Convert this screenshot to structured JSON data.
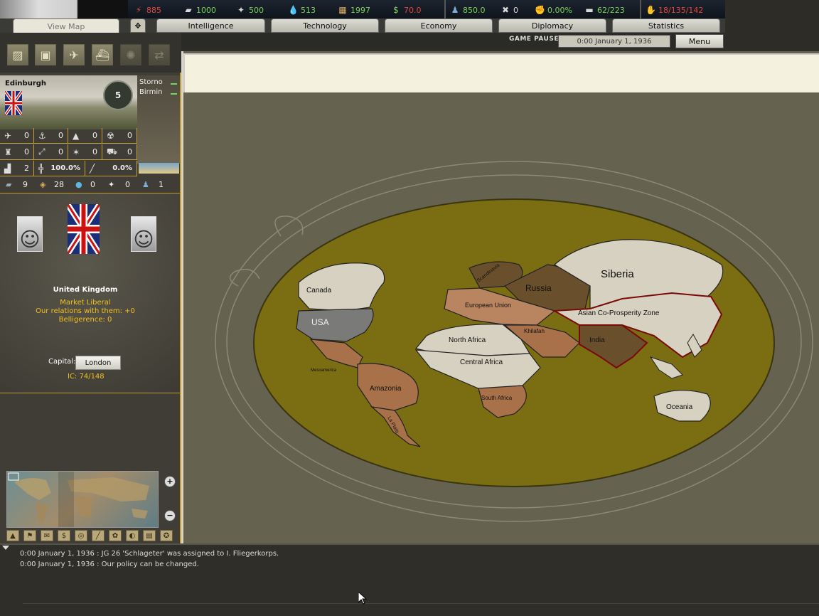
{
  "topbar": {
    "resources": [
      {
        "icon": "energy-icon",
        "value": "885",
        "color": "red"
      },
      {
        "icon": "metal-icon",
        "value": "1000",
        "color": "green"
      },
      {
        "icon": "rare-materials-icon",
        "value": "500",
        "color": "green"
      },
      {
        "icon": "oil-icon",
        "value": "513",
        "color": "green"
      },
      {
        "icon": "supplies-icon",
        "value": "1997",
        "color": "green"
      },
      {
        "icon": "money-icon",
        "value": "70.0",
        "color": "red"
      },
      {
        "icon": "manpower-icon",
        "value": "850.0",
        "color": "green"
      },
      {
        "icon": "dissent-icon",
        "value": "0",
        "color": "white"
      },
      {
        "icon": "national-unity-icon",
        "value": "0.00%",
        "color": "green"
      },
      {
        "icon": "transport-icon",
        "value": "62/223",
        "color": "green"
      },
      {
        "icon": "leadership-icon",
        "value": "18/135/142",
        "color": "red"
      }
    ]
  },
  "tabs": [
    {
      "label": "View Map",
      "active": true
    },
    {
      "label": "Intelligence"
    },
    {
      "label": "Technology"
    },
    {
      "label": "Economy"
    },
    {
      "label": "Diplomacy"
    },
    {
      "label": "Statistics"
    }
  ],
  "status": {
    "paused_label": "GAME PAUSED",
    "date": "0:00 January 1, 1936",
    "menu_label": "Menu"
  },
  "province": {
    "name": "Edinburgh",
    "star_level": "5",
    "neighbors": [
      "Storno",
      "Birmin"
    ],
    "stats": [
      [
        "0",
        "0",
        "0",
        "0"
      ],
      [
        "0",
        "0",
        "0",
        "0"
      ],
      [
        "2",
        "100.0%",
        "0.0%"
      ]
    ],
    "resources": [
      "9",
      "28",
      "0",
      "0",
      "1"
    ]
  },
  "nation": {
    "name": "United Kingdom",
    "ideology": "Market Liberal",
    "relations": "Our relations with them: +0",
    "belligerence": "Belligerence: 0",
    "capital_label": "Capital:",
    "capital": "London",
    "ic": "IC: 74/148"
  },
  "map": {
    "regions": [
      "Canada",
      "USA",
      "Mesoamerica",
      "Amazonia",
      "La Plata",
      "Scandinavia",
      "Russia",
      "Siberia",
      "European Union",
      "Asian Co-Prosperity Zone",
      "North Africa",
      "Khilafah",
      "Central Africa",
      "South Africa",
      "India",
      "Oceania"
    ],
    "colors": {
      "ocean": "#7a6d12",
      "frame": "#65624f",
      "outline": "#8c8a70"
    }
  },
  "log": [
    "0:00 January 1, 1936 : JG 26 'Schlageter' was assigned to I. Fliegerkorps.",
    "0:00 January 1, 1936 : Our policy can be changed."
  ]
}
